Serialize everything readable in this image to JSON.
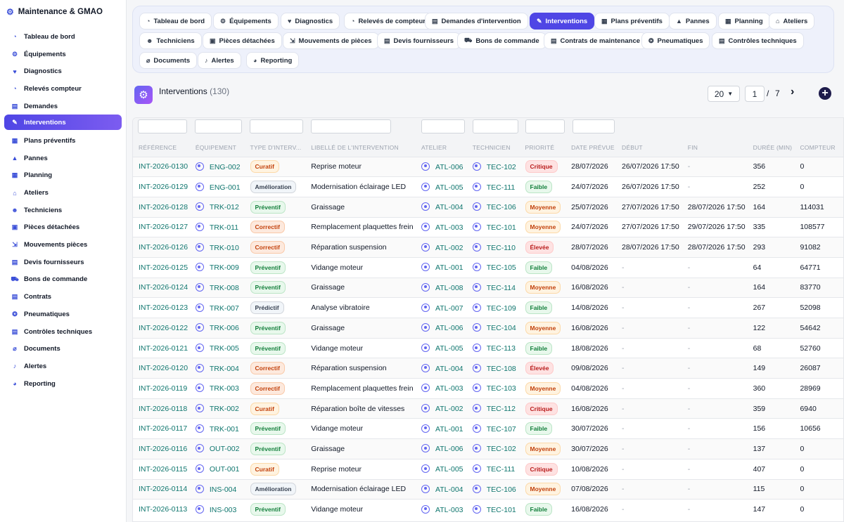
{
  "app": {
    "title": "Maintenance & GMAO"
  },
  "sidebar": {
    "items": [
      {
        "label": "Tableau de bord",
        "icon": "dashboard-icon",
        "glyph": "◔"
      },
      {
        "label": "Équipements",
        "icon": "cogs-icon",
        "glyph": "⚙"
      },
      {
        "label": "Diagnostics",
        "icon": "stethoscope-icon",
        "glyph": "♥"
      },
      {
        "label": "Relevés compteur",
        "icon": "gauge-icon",
        "glyph": "◔"
      },
      {
        "label": "Demandes",
        "icon": "clipboard-icon",
        "glyph": "▤"
      },
      {
        "label": "Interventions",
        "icon": "wrench-icon",
        "glyph": "✎",
        "active": true
      },
      {
        "label": "Plans préventifs",
        "icon": "calendar-icon",
        "glyph": "▦"
      },
      {
        "label": "Pannes",
        "icon": "warning-icon",
        "glyph": "▲"
      },
      {
        "label": "Planning",
        "icon": "calendar-icon",
        "glyph": "▦"
      },
      {
        "label": "Ateliers",
        "icon": "warehouse-icon",
        "glyph": "⌂"
      },
      {
        "label": "Techniciens",
        "icon": "users-icon",
        "glyph": "☻"
      },
      {
        "label": "Pièces détachées",
        "icon": "box-icon",
        "glyph": "▣"
      },
      {
        "label": "Mouvements pièces",
        "icon": "dolly-icon",
        "glyph": "⇲"
      },
      {
        "label": "Devis fournisseurs",
        "icon": "file-icon",
        "glyph": "▤"
      },
      {
        "label": "Bons de commande",
        "icon": "cart-icon",
        "glyph": "⛟"
      },
      {
        "label": "Contrats",
        "icon": "contract-icon",
        "glyph": "▤"
      },
      {
        "label": "Pneumatiques",
        "icon": "tire-icon",
        "glyph": "❂"
      },
      {
        "label": "Contrôles techniques",
        "icon": "clipboard-check-icon",
        "glyph": "▤"
      },
      {
        "label": "Documents",
        "icon": "paperclip-icon",
        "glyph": "⌀"
      },
      {
        "label": "Alertes",
        "icon": "bell-icon",
        "glyph": "♪"
      },
      {
        "label": "Reporting",
        "icon": "pie-chart-icon",
        "glyph": "◕"
      }
    ]
  },
  "tabs": [
    {
      "label": "Tableau de bord",
      "icon": "dashboard-icon",
      "glyph": "◔"
    },
    {
      "label": "Équipements",
      "icon": "cogs-icon",
      "glyph": "⚙"
    },
    {
      "label": "Diagnostics",
      "icon": "stethoscope-icon",
      "glyph": "♥"
    },
    {
      "label": "Relevés de compteur",
      "icon": "gauge-icon",
      "glyph": "◔"
    },
    {
      "label": "Demandes d'intervention",
      "icon": "clipboard-icon",
      "glyph": "▤"
    },
    {
      "label": "Interventions",
      "icon": "wrench-icon",
      "glyph": "✎",
      "active": true
    },
    {
      "label": "Plans préventifs",
      "icon": "calendar-icon",
      "glyph": "▦"
    },
    {
      "label": "Pannes",
      "icon": "warning-icon",
      "glyph": "▲"
    },
    {
      "label": "Planning",
      "icon": "calendar-icon",
      "glyph": "▦"
    },
    {
      "label": "Ateliers",
      "icon": "warehouse-icon",
      "glyph": "⌂"
    },
    {
      "label": "Techniciens",
      "icon": "users-icon",
      "glyph": "☻"
    },
    {
      "label": "Pièces détachées",
      "icon": "box-icon",
      "glyph": "▣"
    },
    {
      "label": "Mouvements de pièces",
      "icon": "dolly-icon",
      "glyph": "⇲"
    },
    {
      "label": "Devis fournisseurs",
      "icon": "file-icon",
      "glyph": "▤"
    },
    {
      "label": "Bons de commande",
      "icon": "cart-icon",
      "glyph": "⛟"
    },
    {
      "label": "Contrats de maintenance",
      "icon": "contract-icon",
      "glyph": "▤"
    },
    {
      "label": "Pneumatiques",
      "icon": "tire-icon",
      "glyph": "❂"
    },
    {
      "label": "Contrôles techniques",
      "icon": "clipboard-check-icon",
      "glyph": "▤"
    },
    {
      "label": "Documents",
      "icon": "paperclip-icon",
      "glyph": "⌀"
    },
    {
      "label": "Alertes",
      "icon": "bell-icon",
      "glyph": "♪"
    },
    {
      "label": "Reporting",
      "icon": "pie-chart-icon",
      "glyph": "◕"
    }
  ],
  "header": {
    "title": "Interventions",
    "count": "(130)"
  },
  "pagination": {
    "per_page": "20",
    "page": "1",
    "separator": "/",
    "total_pages": "7",
    "next": "›",
    "add": "+"
  },
  "table": {
    "columns": [
      "RÉFÉRENCE",
      "ÉQUIPEMENT",
      "TYPE D'INTERV...",
      "LIBELLÉ DE L'INTERVENTION",
      "ATELIER",
      "TECHNICIEN",
      "PRIORITÉ",
      "DATE PRÉVUE",
      "DÉBUT",
      "FIN",
      "DURÉE (MIN)",
      "COMPTEUR"
    ],
    "rows": [
      {
        "ref": "INT-2026-0130",
        "equip": "ENG-002",
        "type": "Curatif",
        "tcls": "b-curatif",
        "label": "Reprise moteur",
        "atelier": "ATL-006",
        "tech": "TEC-102",
        "prio": "Critique",
        "pcls": "p-critique",
        "date": "28/07/2026",
        "debut": "26/07/2026 17:50",
        "fin": "-",
        "duree": "356",
        "compteur": "0"
      },
      {
        "ref": "INT-2026-0129",
        "equip": "ENG-001",
        "type": "Amélioration",
        "tcls": "b-amelioration",
        "label": "Modernisation éclairage LED",
        "atelier": "ATL-005",
        "tech": "TEC-111",
        "prio": "Faible",
        "pcls": "p-faible",
        "date": "24/07/2026",
        "debut": "26/07/2026 17:50",
        "fin": "-",
        "duree": "252",
        "compteur": "0"
      },
      {
        "ref": "INT-2026-0128",
        "equip": "TRK-012",
        "type": "Préventif",
        "tcls": "b-preventif",
        "label": "Graissage",
        "atelier": "ATL-004",
        "tech": "TEC-106",
        "prio": "Moyenne",
        "pcls": "p-moyenne",
        "date": "25/07/2026",
        "debut": "27/07/2026 17:50",
        "fin": "28/07/2026 17:50",
        "duree": "164",
        "compteur": "114031"
      },
      {
        "ref": "INT-2026-0127",
        "equip": "TRK-011",
        "type": "Correctif",
        "tcls": "b-correctif",
        "label": "Remplacement plaquettes frein",
        "atelier": "ATL-003",
        "tech": "TEC-101",
        "prio": "Moyenne",
        "pcls": "p-moyenne",
        "date": "24/07/2026",
        "debut": "27/07/2026 17:50",
        "fin": "29/07/2026 17:50",
        "duree": "335",
        "compteur": "108577"
      },
      {
        "ref": "INT-2026-0126",
        "equip": "TRK-010",
        "type": "Correctif",
        "tcls": "b-correctif",
        "label": "Réparation suspension",
        "atelier": "ATL-002",
        "tech": "TEC-110",
        "prio": "Élevée",
        "pcls": "p-elevee",
        "date": "28/07/2026",
        "debut": "28/07/2026 17:50",
        "fin": "28/07/2026 17:50",
        "duree": "293",
        "compteur": "91082"
      },
      {
        "ref": "INT-2026-0125",
        "equip": "TRK-009",
        "type": "Préventif",
        "tcls": "b-preventif",
        "label": "Vidange moteur",
        "atelier": "ATL-001",
        "tech": "TEC-105",
        "prio": "Faible",
        "pcls": "p-faible",
        "date": "04/08/2026",
        "debut": "-",
        "fin": "-",
        "duree": "64",
        "compteur": "64771"
      },
      {
        "ref": "INT-2026-0124",
        "equip": "TRK-008",
        "type": "Préventif",
        "tcls": "b-preventif",
        "label": "Graissage",
        "atelier": "ATL-008",
        "tech": "TEC-114",
        "prio": "Moyenne",
        "pcls": "p-moyenne",
        "date": "16/08/2026",
        "debut": "-",
        "fin": "-",
        "duree": "164",
        "compteur": "83770"
      },
      {
        "ref": "INT-2026-0123",
        "equip": "TRK-007",
        "type": "Prédictif",
        "tcls": "b-predictif",
        "label": "Analyse vibratoire",
        "atelier": "ATL-007",
        "tech": "TEC-109",
        "prio": "Faible",
        "pcls": "p-faible",
        "date": "14/08/2026",
        "debut": "-",
        "fin": "-",
        "duree": "267",
        "compteur": "52098"
      },
      {
        "ref": "INT-2026-0122",
        "equip": "TRK-006",
        "type": "Préventif",
        "tcls": "b-preventif",
        "label": "Graissage",
        "atelier": "ATL-006",
        "tech": "TEC-104",
        "prio": "Moyenne",
        "pcls": "p-moyenne",
        "date": "16/08/2026",
        "debut": "-",
        "fin": "-",
        "duree": "122",
        "compteur": "54642"
      },
      {
        "ref": "INT-2026-0121",
        "equip": "TRK-005",
        "type": "Préventif",
        "tcls": "b-preventif",
        "label": "Vidange moteur",
        "atelier": "ATL-005",
        "tech": "TEC-113",
        "prio": "Faible",
        "pcls": "p-faible",
        "date": "18/08/2026",
        "debut": "-",
        "fin": "-",
        "duree": "68",
        "compteur": "52760"
      },
      {
        "ref": "INT-2026-0120",
        "equip": "TRK-004",
        "type": "Correctif",
        "tcls": "b-correctif",
        "label": "Réparation suspension",
        "atelier": "ATL-004",
        "tech": "TEC-108",
        "prio": "Élevée",
        "pcls": "p-elevee",
        "date": "09/08/2026",
        "debut": "-",
        "fin": "-",
        "duree": "149",
        "compteur": "26087"
      },
      {
        "ref": "INT-2026-0119",
        "equip": "TRK-003",
        "type": "Correctif",
        "tcls": "b-correctif",
        "label": "Remplacement plaquettes frein",
        "atelier": "ATL-003",
        "tech": "TEC-103",
        "prio": "Moyenne",
        "pcls": "p-moyenne",
        "date": "04/08/2026",
        "debut": "-",
        "fin": "-",
        "duree": "360",
        "compteur": "28969"
      },
      {
        "ref": "INT-2026-0118",
        "equip": "TRK-002",
        "type": "Curatif",
        "tcls": "b-curatif",
        "label": "Réparation boîte de vitesses",
        "atelier": "ATL-002",
        "tech": "TEC-112",
        "prio": "Critique",
        "pcls": "p-critique",
        "date": "16/08/2026",
        "debut": "-",
        "fin": "-",
        "duree": "359",
        "compteur": "6940"
      },
      {
        "ref": "INT-2026-0117",
        "equip": "TRK-001",
        "type": "Préventif",
        "tcls": "b-preventif",
        "label": "Vidange moteur",
        "atelier": "ATL-001",
        "tech": "TEC-107",
        "prio": "Faible",
        "pcls": "p-faible",
        "date": "30/07/2026",
        "debut": "-",
        "fin": "-",
        "duree": "156",
        "compteur": "10656"
      },
      {
        "ref": "INT-2026-0116",
        "equip": "OUT-002",
        "type": "Préventif",
        "tcls": "b-preventif",
        "label": "Graissage",
        "atelier": "ATL-006",
        "tech": "TEC-102",
        "prio": "Moyenne",
        "pcls": "p-moyenne",
        "date": "30/07/2026",
        "debut": "-",
        "fin": "-",
        "duree": "137",
        "compteur": "0"
      },
      {
        "ref": "INT-2026-0115",
        "equip": "OUT-001",
        "type": "Curatif",
        "tcls": "b-curatif",
        "label": "Reprise moteur",
        "atelier": "ATL-005",
        "tech": "TEC-111",
        "prio": "Critique",
        "pcls": "p-critique",
        "date": "10/08/2026",
        "debut": "-",
        "fin": "-",
        "duree": "407",
        "compteur": "0"
      },
      {
        "ref": "INT-2026-0114",
        "equip": "INS-004",
        "type": "Amélioration",
        "tcls": "b-amelioration",
        "label": "Modernisation éclairage LED",
        "atelier": "ATL-004",
        "tech": "TEC-106",
        "prio": "Moyenne",
        "pcls": "p-moyenne",
        "date": "07/08/2026",
        "debut": "-",
        "fin": "-",
        "duree": "115",
        "compteur": "0"
      },
      {
        "ref": "INT-2026-0113",
        "equip": "INS-003",
        "type": "Préventif",
        "tcls": "b-preventif",
        "label": "Vidange moteur",
        "atelier": "ATL-003",
        "tech": "TEC-101",
        "prio": "Faible",
        "pcls": "p-faible",
        "date": "16/08/2026",
        "debut": "-",
        "fin": "-",
        "duree": "147",
        "compteur": "0"
      }
    ]
  }
}
